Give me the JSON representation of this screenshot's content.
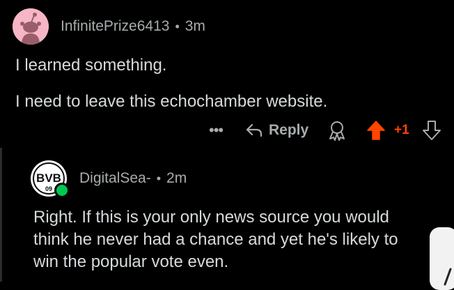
{
  "comment": {
    "username": "InfinitePrize6413",
    "separator": "•",
    "time": "3m",
    "body": [
      "I learned something.",
      "I need to leave this echochamber website."
    ]
  },
  "actions": {
    "more_label": "•••",
    "reply_label": "Reply",
    "score": "+1",
    "upvote_state": "upvoted",
    "accent_color": "#ff4500"
  },
  "reply": {
    "username": "DigitalSea-",
    "separator": "•",
    "time": "2m",
    "avatar_text": "BVB",
    "avatar_subtext": "09",
    "online": true,
    "body": [
      "Right. If this is your only news source you would",
      "think he never had a chance and yet he's likely to",
      "win the popular vote even."
    ]
  },
  "icons": {
    "avatar": "snoo-avatar-icon",
    "reply": "reply-arrow-icon",
    "award": "award-icon",
    "upvote": "upvote-arrow-icon",
    "downvote": "downvote-arrow-icon"
  }
}
